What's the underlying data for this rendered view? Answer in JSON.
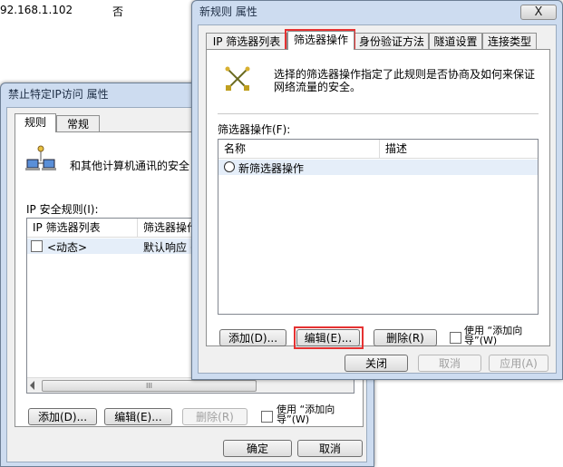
{
  "bg_row": {
    "ip": "92.168.1.102",
    "value": "否"
  },
  "back_dialog": {
    "title": "禁止特定IP访问 属性",
    "tabs": [
      "规则",
      "常规"
    ],
    "description": "和其他计算机通讯的安全",
    "rules_label": "IP 安全规则(I):",
    "columns": [
      "IP 筛选器列表",
      "筛选器操作"
    ],
    "rows": [
      {
        "name": "<动态>",
        "action": "默认响应 ("
      }
    ],
    "buttons": {
      "add": "添加(D)...",
      "edit": "编辑(E)...",
      "remove": "删除(R)",
      "wizard": "使用 “添加向导”(W)"
    },
    "ok": "确定",
    "cancel": "取消",
    "scroll_mid": "III"
  },
  "front_dialog": {
    "title": "新规则 属性",
    "close_glyph": "X",
    "tabs": [
      "IP 筛选器列表",
      "筛选器操作",
      "身份验证方法",
      "隧道设置",
      "连接类型"
    ],
    "active_tab": 1,
    "description": "选择的筛选器操作指定了此规则是否协商及如何来保证网络流量的安全。",
    "list_label": "筛选器操作(F):",
    "columns": [
      "名称",
      "描述"
    ],
    "rows": [
      {
        "name": "新筛选器操作"
      }
    ],
    "buttons": {
      "add": "添加(D)...",
      "edit": "编辑(E)...",
      "remove": "删除(R)",
      "wizard": "使用 “添加向导”(W)"
    },
    "close_btn": "关闭",
    "cancel": "取消",
    "apply": "应用(A)"
  },
  "colors": {
    "highlight_red": "#e53232",
    "window_frame": "#cddcf0",
    "selection": "#e5eef9"
  }
}
